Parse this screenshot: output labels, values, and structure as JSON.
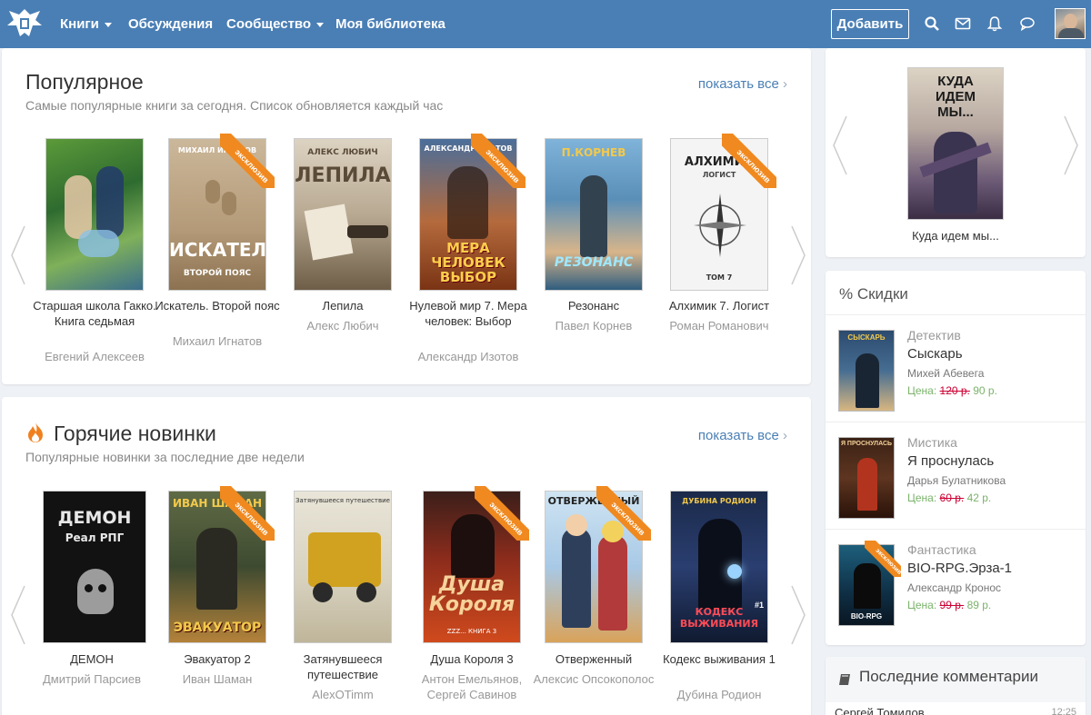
{
  "nav": {
    "items": [
      {
        "label": "Книги",
        "caret": true
      },
      {
        "label": "Обсуждения",
        "caret": false
      },
      {
        "label": "Сообщество",
        "caret": true
      },
      {
        "label": "Моя библиотека",
        "caret": false
      }
    ],
    "add_label": "Добавить",
    "icons": [
      "search-icon",
      "mail-icon",
      "bell-icon",
      "chat-icon"
    ]
  },
  "popular": {
    "title": "Популярное",
    "subtitle": "Самые популярные книги за сегодня. Список обновляется каждый час",
    "show_all": "показать все",
    "books": [
      {
        "title": "Старшая школа Гакко. Книга седьмая",
        "author": "Евгений Алексеев",
        "exclusive": false
      },
      {
        "title": "Искатель. Второй пояс",
        "author": "Михаил Игнатов",
        "exclusive": true,
        "cover_text": "ИСКАТЕЛЬ",
        "cover_sub": "ВТОРОЙ ПОЯС",
        "cover_top": "МИХАИЛ ИГНАТОВ"
      },
      {
        "title": "Лепила",
        "author": "Алекс Любич",
        "exclusive": false,
        "cover_text": "ЛЕПИЛА",
        "cover_top": "АЛЕКС ЛЮБИЧ"
      },
      {
        "title": "Нулевой мир 7. Мера человек: Выбор",
        "author": "Александр Изотов",
        "exclusive": true,
        "cover_text": "МЕРА ЧЕЛОВЕК ВЫБОР",
        "cover_sub": "ТОМ 7",
        "cover_top": "АЛЕКСАНДР ИЗОТОВ"
      },
      {
        "title": "Резонанс",
        "author": "Павел Корнев",
        "exclusive": false,
        "cover_text": "РЕЗОНАНС",
        "cover_top": "П.КОРНЕВ"
      },
      {
        "title": "Алхимик 7. Логист",
        "author": "Роман Романович",
        "exclusive": true,
        "cover_text": "АЛХИМИК",
        "cover_sub": "ТОМ 7",
        "cover_top": "ЛОГИСТ"
      }
    ]
  },
  "hot": {
    "title": "Горячие новинки",
    "subtitle": "Популярные новинки за последние две недели",
    "show_all": "показать все",
    "books": [
      {
        "title": "ДЕМОН",
        "author": "Дмитрий Парсиев",
        "exclusive": false,
        "cover_text": "ДЕМОН",
        "cover_sub": "Реал РПГ"
      },
      {
        "title": "Эвакуатор 2",
        "author": "Иван Шаман",
        "exclusive": true,
        "cover_text": "ЭВАКУАТОР",
        "cover_top": "ИВАН ШАМАН"
      },
      {
        "title": "Затянувшееся путешествие",
        "author": "AlexOTimm",
        "exclusive": false,
        "cover_top": "Затянувшееся путешествие"
      },
      {
        "title": "Душа Короля 3",
        "author": "Антон Емельянов, Сергей Савинов",
        "exclusive": true,
        "cover_text": "Душа Короля",
        "cover_sub": "ZZZ... КНИГА 3"
      },
      {
        "title": "Отверженный",
        "author": "Алексис Опсокополос",
        "exclusive": true,
        "cover_top": "ОТВЕРЖЕННЫЙ"
      },
      {
        "title": "Кодекс выживания 1",
        "author": "Дубина Родион",
        "exclusive": false,
        "cover_text": "КОДЕКС ВЫЖИВАНИЯ",
        "cover_top": "ДУБИНА РОДИОН",
        "cover_sub": "#1"
      }
    ]
  },
  "exclusive_label": "эксклюзив",
  "feature": {
    "label": "Куда идем мы...",
    "cover_text": "КУДА ИДЕМ МЫ..."
  },
  "discounts": {
    "title": "% Скидки",
    "price_label": "Цена:",
    "items": [
      {
        "genre": "Детектив",
        "title": "Сыскарь",
        "author": "Михей Абевега",
        "old_price": "120 р.",
        "new_price": "90 р.",
        "cover_text": "СЫСКАРЬ",
        "exclusive": false
      },
      {
        "genre": "Мистика",
        "title": "Я проснулась",
        "author": "Дарья Булатникова",
        "old_price": "60 р.",
        "new_price": "42 р.",
        "cover_text": "Я ПРОСНУЛАСЬ",
        "exclusive": false
      },
      {
        "genre": "Фантастика",
        "title": "BIO-RPG.Эрза-1",
        "author": "Александр Кронос",
        "old_price": "99 р.",
        "new_price": "89 р.",
        "cover_text": "BIO-RPG",
        "exclusive": true
      }
    ]
  },
  "comments": {
    "title": "Последние комментарии",
    "first_author": "Сергей Томилов",
    "first_time": "12:25"
  }
}
